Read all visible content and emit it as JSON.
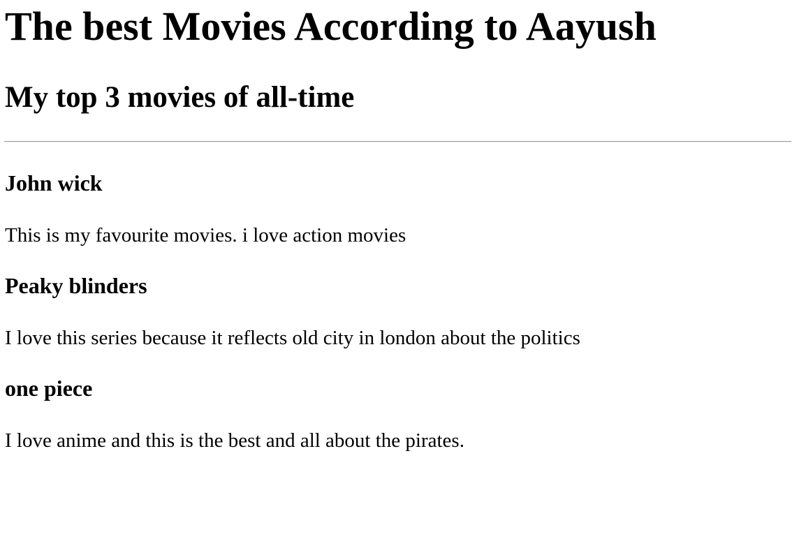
{
  "page": {
    "title": "The best Movies According to Aayush",
    "subtitle": "My top 3 movies of all-time"
  },
  "movies": [
    {
      "title": "John wick",
      "description": "This is my favourite movies. i love action movies"
    },
    {
      "title": "Peaky blinders",
      "description": "I love this series because it reflects old city in london about the politics"
    },
    {
      "title": "one piece",
      "description": "I love anime and this is the best and all about the pirates."
    }
  ]
}
